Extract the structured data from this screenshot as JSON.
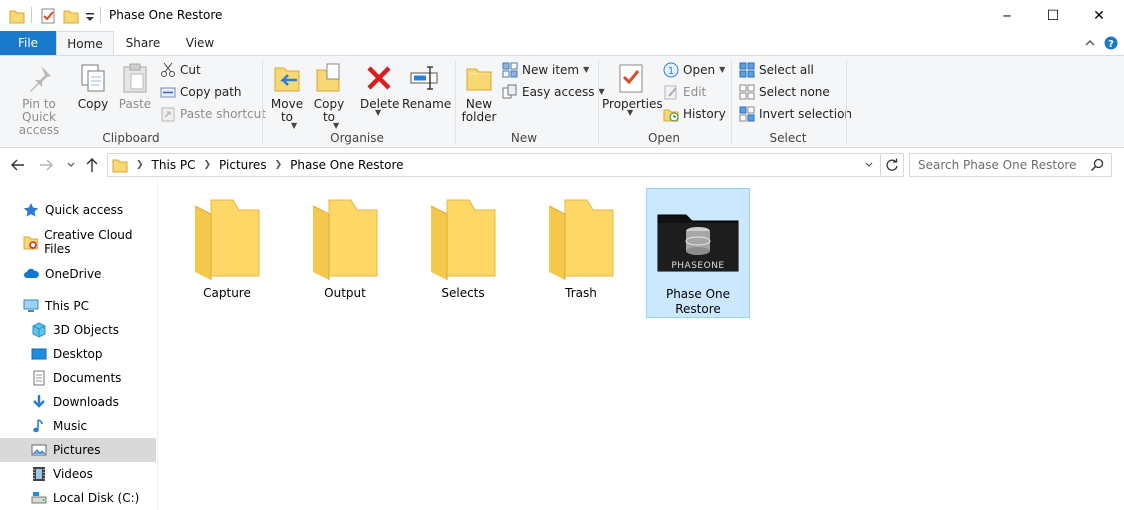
{
  "window": {
    "title": "Phase One Restore",
    "minimize": "─",
    "maximize": "☐",
    "close": "✕"
  },
  "tabs": [
    "File",
    "Home",
    "Share",
    "View"
  ],
  "ribbon": {
    "clipboard": {
      "label": "Clipboard",
      "pin": "Pin to Quick access",
      "copy": "Copy",
      "paste": "Paste",
      "cut": "Cut",
      "copy_path": "Copy path",
      "paste_shortcut": "Paste shortcut"
    },
    "organise": {
      "label": "Organise",
      "move_to": "Move to",
      "copy_to": "Copy to",
      "delete": "Delete",
      "rename": "Rename"
    },
    "new": {
      "label": "New",
      "new_folder": "New folder",
      "new_item": "New item",
      "easy_access": "Easy access"
    },
    "open": {
      "label": "Open",
      "properties": "Properties",
      "open": "Open",
      "edit": "Edit",
      "history": "History"
    },
    "select": {
      "label": "Select",
      "select_all": "Select all",
      "select_none": "Select none",
      "invert": "Invert selection"
    }
  },
  "address": {
    "crumbs": [
      "This PC",
      "Pictures",
      "Phase One Restore"
    ],
    "search_placeholder": "Search Phase One Restore"
  },
  "nav": {
    "quick_access": "Quick access",
    "creative_cloud": "Creative Cloud Files",
    "onedrive": "OneDrive",
    "this_pc": "This PC",
    "objects3d": "3D Objects",
    "desktop": "Desktop",
    "documents": "Documents",
    "downloads": "Downloads",
    "music": "Music",
    "pictures": "Pictures",
    "videos": "Videos",
    "local_disk": "Local Disk (C:)"
  },
  "files": [
    {
      "name": "Capture"
    },
    {
      "name": "Output"
    },
    {
      "name": "Selects"
    },
    {
      "name": "Trash"
    },
    {
      "name": "Phase One Restore",
      "logo_text": "PHASEONE"
    }
  ],
  "colors": {
    "file_tab": "#1979ca",
    "folder": "#ffd766",
    "selection": "#cce8ff"
  }
}
